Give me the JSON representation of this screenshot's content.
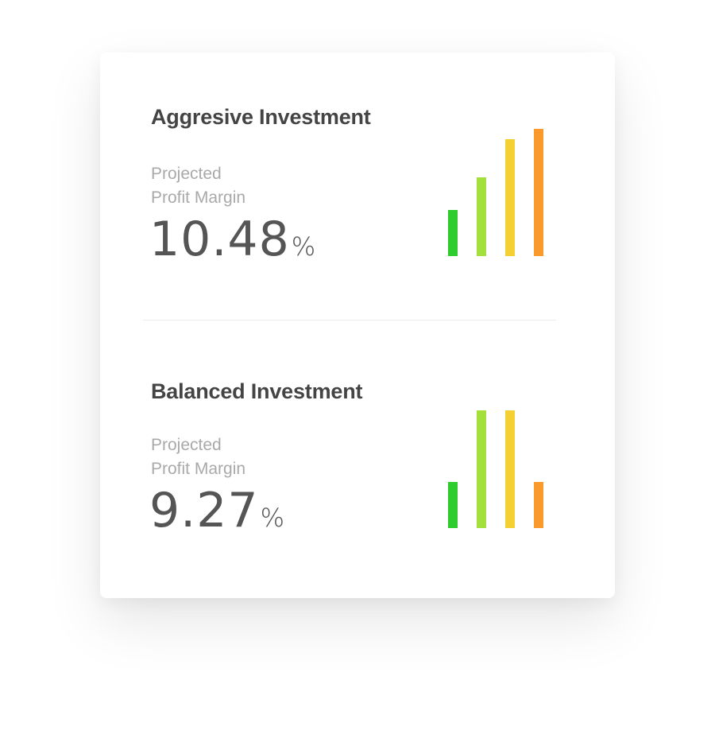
{
  "panels": [
    {
      "title": "Aggresive Investment",
      "label_line1": "Projected",
      "label_line2": "Profit Margin",
      "value": "10.48",
      "unit": "%",
      "bars": [
        {
          "level": 0.36,
          "color": "#2ecc2e"
        },
        {
          "level": 0.62,
          "color": "#a4e03c"
        },
        {
          "level": 0.92,
          "color": "#f5d033"
        },
        {
          "level": 1.0,
          "color": "#fb9a2c"
        }
      ]
    },
    {
      "title": "Balanced Investment",
      "label_line1": "Projected",
      "label_line2": "Profit Margin",
      "value": "9.27",
      "unit": "%",
      "bars": [
        {
          "level": 0.39,
          "color": "#2ecc2e"
        },
        {
          "level": 1.0,
          "color": "#a4e03c"
        },
        {
          "level": 1.0,
          "color": "#f5d033"
        },
        {
          "level": 0.39,
          "color": "#fb9a2c"
        }
      ]
    }
  ]
}
